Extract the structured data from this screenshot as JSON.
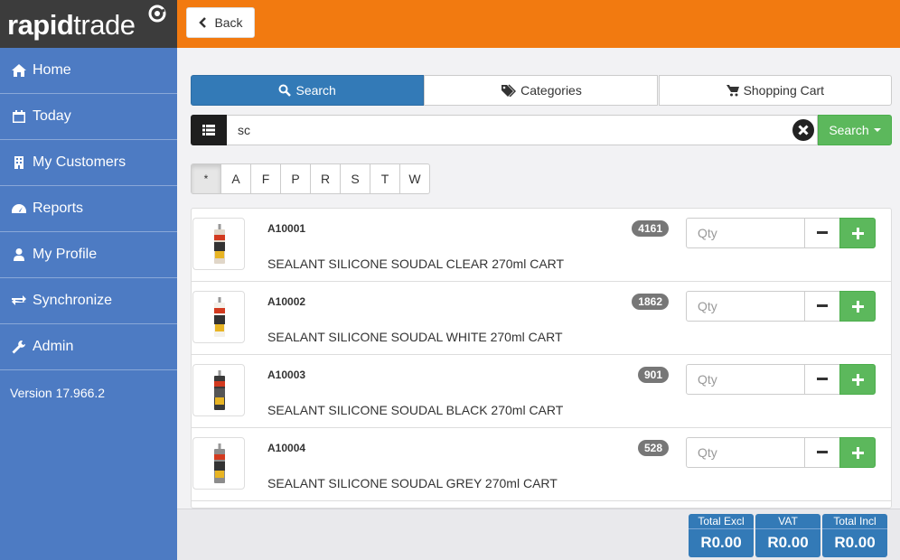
{
  "app": {
    "brand_bold": "rapid",
    "brand_rest": "trade"
  },
  "sidebar": {
    "items": [
      {
        "label": "Home",
        "icon": "home-icon"
      },
      {
        "label": "Today",
        "icon": "calendar-icon"
      },
      {
        "label": "My Customers",
        "icon": "building-icon"
      },
      {
        "label": "Reports",
        "icon": "dashboard-icon"
      },
      {
        "label": "My Profile",
        "icon": "user-icon"
      },
      {
        "label": "Synchronize",
        "icon": "exchange-icon"
      },
      {
        "label": "Admin",
        "icon": "wrench-icon"
      }
    ],
    "version": "Version 17.966.2"
  },
  "topbar": {
    "back_label": "Back"
  },
  "tabs": [
    {
      "label": "Search",
      "icon": "search-icon",
      "active": true
    },
    {
      "label": "Categories",
      "icon": "tags-icon",
      "active": false
    },
    {
      "label": "Shopping Cart",
      "icon": "cart-icon",
      "active": false
    }
  ],
  "search": {
    "value": "sc",
    "button_label": "Search"
  },
  "alphabet": [
    "*",
    "A",
    "F",
    "P",
    "R",
    "S",
    "T",
    "W"
  ],
  "products": [
    {
      "code": "A10001",
      "description": "SEALANT SILICONE SOUDAL CLEAR 270ml CART",
      "stock": "4161",
      "qty_placeholder": "Qty"
    },
    {
      "code": "A10002",
      "description": "SEALANT SILICONE SOUDAL WHITE 270ml CART",
      "stock": "1862",
      "qty_placeholder": "Qty"
    },
    {
      "code": "A10003",
      "description": "SEALANT SILICONE SOUDAL BLACK 270ml CART",
      "stock": "901",
      "qty_placeholder": "Qty"
    },
    {
      "code": "A10004",
      "description": "SEALANT SILICONE SOUDAL GREY 270ml CART",
      "stock": "528",
      "qty_placeholder": "Qty"
    }
  ],
  "totals": [
    {
      "label": "Total Excl",
      "value": "R0.00"
    },
    {
      "label": "VAT",
      "value": "R0.00"
    },
    {
      "label": "Total Incl",
      "value": "R0.00"
    }
  ],
  "colors": {
    "sidebar_bg": "#4d7bc3",
    "topbar_bg": "#f27a10",
    "primary": "#337ab7",
    "success": "#5cb85c"
  }
}
